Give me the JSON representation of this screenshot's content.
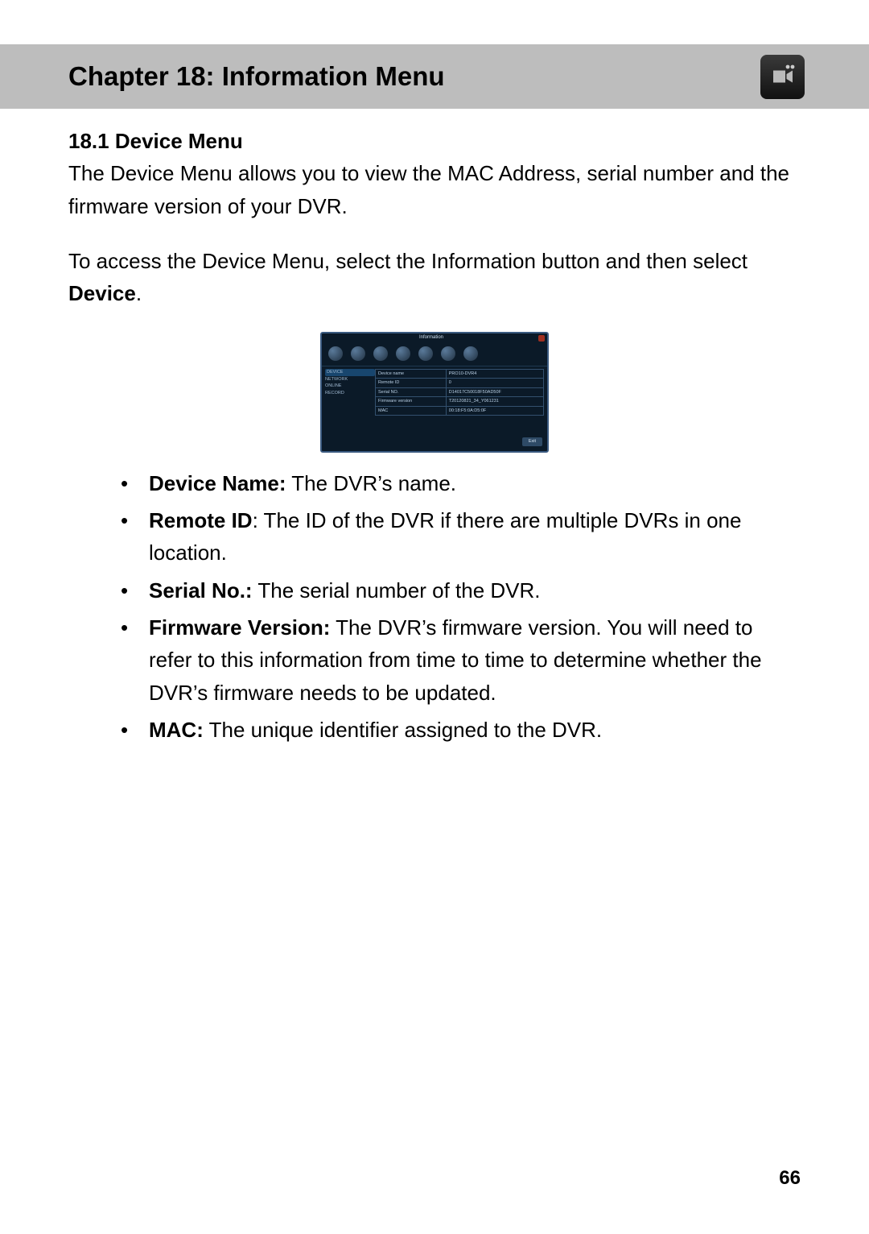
{
  "chapter_title": "Chapter 18: Information Menu",
  "section_title": "18.1 Device Menu",
  "intro_para": "The Device Menu allows you to view the MAC Address, serial number and the firmware version of your DVR.",
  "access_para_pre": "To access the Device Menu, select the Information button and then select ",
  "access_para_bold": "Device",
  "access_para_post": ".",
  "dvr": {
    "window_title": "Information",
    "sidebar": [
      "DEVICE",
      "NETWORK",
      "ONLINE",
      "RECORD"
    ],
    "rows": [
      {
        "label": "Device name",
        "value": "PRO10-DVR4"
      },
      {
        "label": "Remote ID",
        "value": "0"
      },
      {
        "label": "Serial NO.",
        "value": "D14017C50018F50AD50F"
      },
      {
        "label": "Firmware version",
        "value": "T20120821_34_Y061231"
      },
      {
        "label": "MAC",
        "value": "00:18:F5:0A:D5:0F"
      }
    ],
    "exit_label": "Exit"
  },
  "bullets": [
    {
      "term": "Device Name:",
      "desc": " The DVR’s name."
    },
    {
      "term": "Remote ID",
      "desc": ": The ID of the DVR if there are multiple DVRs in one location."
    },
    {
      "term": "Serial No.:",
      "desc": " The serial number of the DVR."
    },
    {
      "term": "Firmware Version:",
      "desc": " The DVR’s firmware version. You will need to refer to this information from time to time to determine whether the DVR’s firmware needs to be updated."
    },
    {
      "term": "MAC:",
      "desc": " The unique identifier assigned to the DVR."
    }
  ],
  "page_number": "66"
}
